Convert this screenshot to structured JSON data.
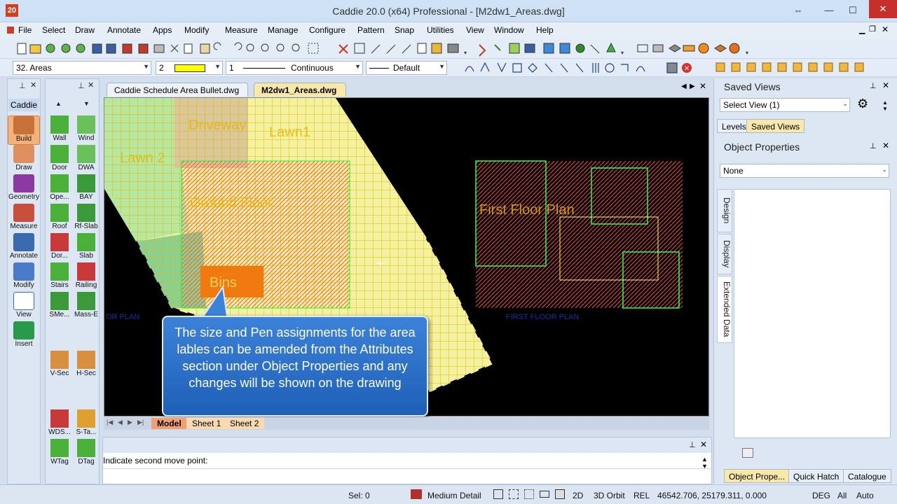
{
  "window": {
    "title": "Caddie 20.0 (x64) Professional - [M2dw1_Areas.dwg]",
    "logo": "20"
  },
  "menu": [
    "File",
    "Select",
    "Draw",
    "Annotate",
    "Apps",
    "Modify",
    "Measure",
    "Manage",
    "Configure",
    "Pattern",
    "Snap",
    "Utilities",
    "View",
    "Window",
    "Help"
  ],
  "toolbar2": {
    "layer": "32. Areas",
    "pen": "2",
    "linetype_num": "1",
    "linetype": "Continuous",
    "lineweight": "Default"
  },
  "left_palette": {
    "tab": "Caddie",
    "items": [
      "Build",
      "Draw",
      "Geometry",
      "Measure",
      "Annotate",
      "Modify",
      "View",
      "Insert"
    ]
  },
  "tool_palette": {
    "items": [
      "Wall",
      "Wind",
      "Door",
      "DWA",
      "Ope...",
      "BAY",
      "Roof",
      "Rf-Slab",
      "Dor...",
      "Slab",
      "Stairs",
      "Railing",
      "SMe...",
      "Mass-E",
      "V-Sec",
      "H-Sec",
      "WDS...",
      "S-Ta...",
      "WTag",
      "DTag"
    ]
  },
  "doc_tabs": [
    "Caddie Schedule Area Bullet.dwg",
    "M2dw1_Areas.dwg"
  ],
  "drawing": {
    "labels": {
      "driveway": "Driveway",
      "lawn1": "Lawn1",
      "lawn2": "Lawn 2",
      "ground_floor": "Ground Floor",
      "bins": "Bins",
      "first_floor": "First Floor Plan",
      "or_plan": "OR PLAN",
      "first_floor_plan_caption": "FIRST FLOOR PLAN"
    }
  },
  "layout_tabs": [
    "Model",
    "Sheet 1",
    "Sheet 2"
  ],
  "callout": "The size and Pen assignments for the area lables can be amended from the Attributes section under Object Properties and any changes will be shown on the drawing",
  "command": {
    "prompt": "Indicate second move point:"
  },
  "right_panel": {
    "saved_views_title": "Saved Views",
    "select_view": "Select View (1)",
    "tabs": [
      "Levels",
      "Saved Views"
    ],
    "object_properties_title": "Object Properties",
    "object_combo": "None",
    "vertical_tabs": [
      "Design",
      "Display",
      "Extended Data"
    ],
    "bottom_tabs": [
      "Object Prope...",
      "Quick Hatch",
      "Catalogue"
    ]
  },
  "status": {
    "sel": "Sel: 0",
    "detail": "Medium Detail",
    "mode2d": "2D",
    "orbit": "3D Orbit",
    "rel": "REL",
    "coords": "46542.706, 25179.311, 0.000",
    "deg": "DEG",
    "all": "All",
    "auto": "Auto"
  },
  "colors": {
    "accent": "#2a6fc9",
    "area_fill": "#f3f2a0",
    "area_grid": "#e8b400",
    "bins": "#f07a10",
    "walls": "#ff3030",
    "plan_green": "#30ff30"
  }
}
